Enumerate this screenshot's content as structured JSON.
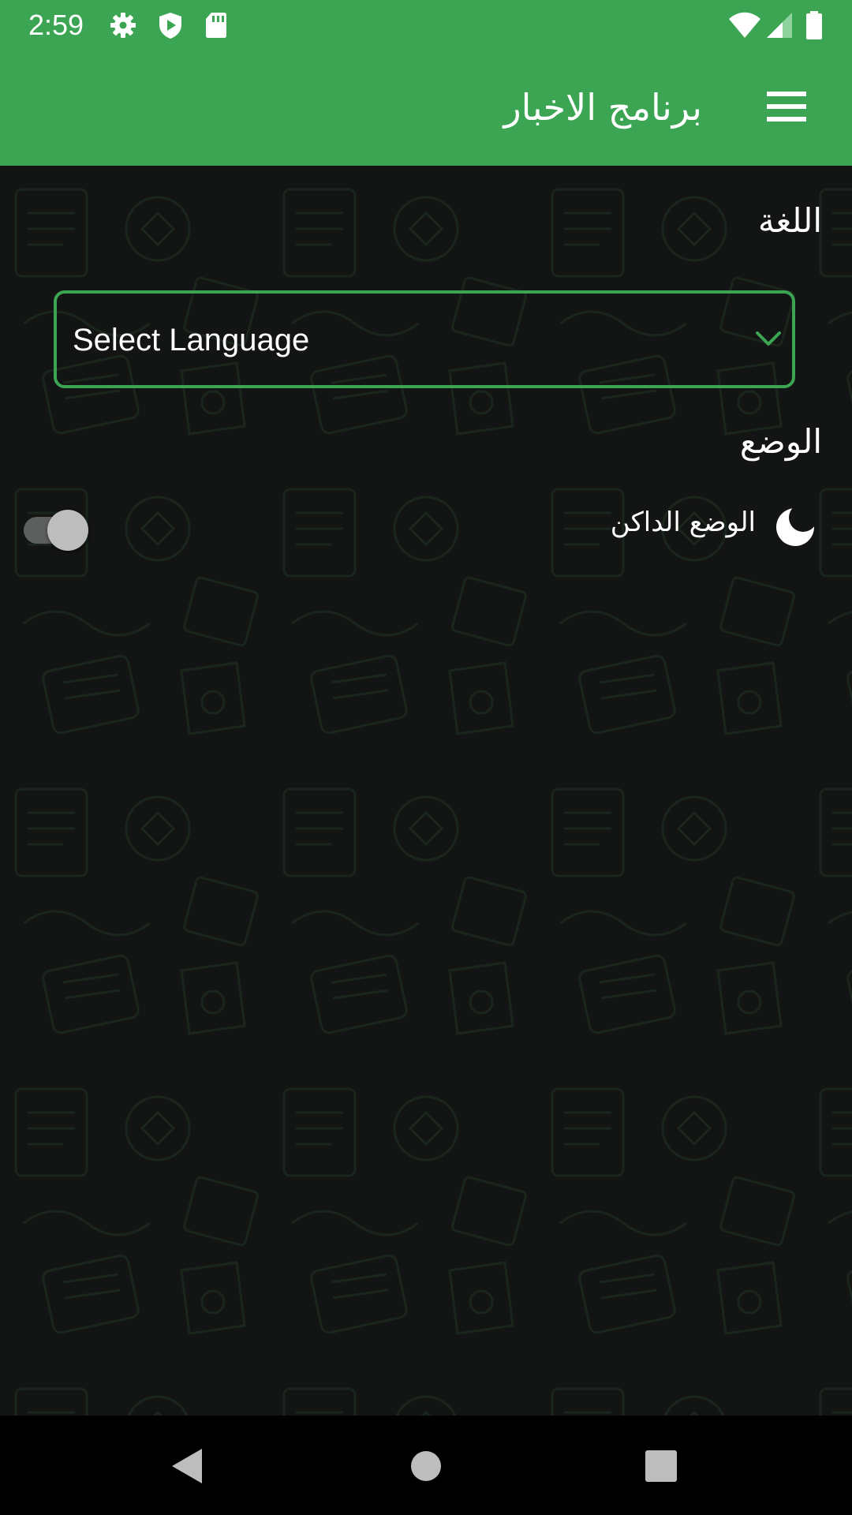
{
  "status_bar": {
    "time": "2:59",
    "icons": [
      "settings-icon",
      "shield-play-icon",
      "sd-card-icon",
      "wifi-icon",
      "signal-icon",
      "battery-icon"
    ]
  },
  "app_bar": {
    "title": "برنامج الاخبار",
    "menu_icon": "hamburger-menu-icon"
  },
  "language_section": {
    "title": "اللغة",
    "select": {
      "value": "Select Language",
      "icon": "chevron-down-icon"
    }
  },
  "mode_section": {
    "title": "الوضع",
    "dark_mode": {
      "label": "الوضع الداكن",
      "icon": "moon-icon",
      "enabled": false
    }
  },
  "nav_bar": {
    "buttons": [
      "back-icon",
      "home-icon",
      "recents-icon"
    ]
  },
  "colors": {
    "accent": "#3ca553",
    "background": "#131414",
    "text": "#ffffff",
    "nav_bar": "#000000"
  }
}
